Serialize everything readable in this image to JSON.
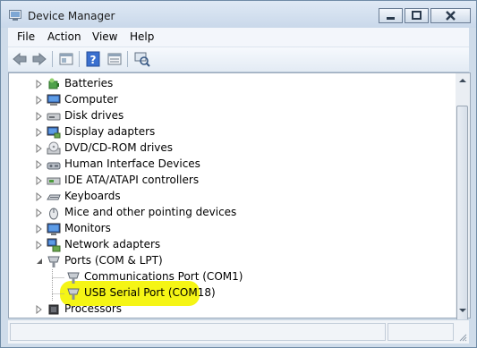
{
  "window": {
    "title": "Device Manager"
  },
  "menu": {
    "file": "File",
    "action": "Action",
    "view": "View",
    "help": "Help"
  },
  "toolbar": {
    "icons": [
      "back-icon",
      "forward-icon",
      "properties-icon",
      "help-icon",
      "show-hide-tree-icon",
      "scan-hardware-icon"
    ]
  },
  "tree": {
    "items": [
      {
        "label": "Batteries",
        "icon": "battery-icon",
        "expanded": false
      },
      {
        "label": "Computer",
        "icon": "computer-icon",
        "expanded": false
      },
      {
        "label": "Disk drives",
        "icon": "disk-drive-icon",
        "expanded": false
      },
      {
        "label": "Display adapters",
        "icon": "display-adapter-icon",
        "expanded": false
      },
      {
        "label": "DVD/CD-ROM drives",
        "icon": "dvd-drive-icon",
        "expanded": false
      },
      {
        "label": "Human Interface Devices",
        "icon": "hid-icon",
        "expanded": false
      },
      {
        "label": "IDE ATA/ATAPI controllers",
        "icon": "ide-controller-icon",
        "expanded": false
      },
      {
        "label": "Keyboards",
        "icon": "keyboard-icon",
        "expanded": false
      },
      {
        "label": "Mice and other pointing devices",
        "icon": "mouse-icon",
        "expanded": false
      },
      {
        "label": "Monitors",
        "icon": "monitor-icon",
        "expanded": false
      },
      {
        "label": "Network adapters",
        "icon": "network-adapter-icon",
        "expanded": false
      },
      {
        "label": "Ports (COM & LPT)",
        "icon": "port-icon",
        "expanded": true,
        "children": [
          {
            "label": "Communications Port (COM1)",
            "icon": "port-icon"
          },
          {
            "label": "USB Serial Port (COM18)",
            "icon": "port-icon",
            "highlighted": true
          }
        ]
      },
      {
        "label": "Processors",
        "icon": "processor-icon",
        "expanded": false
      }
    ]
  },
  "colors": {
    "highlight": "#f5f515",
    "titlebar": "#dfe9f5"
  }
}
